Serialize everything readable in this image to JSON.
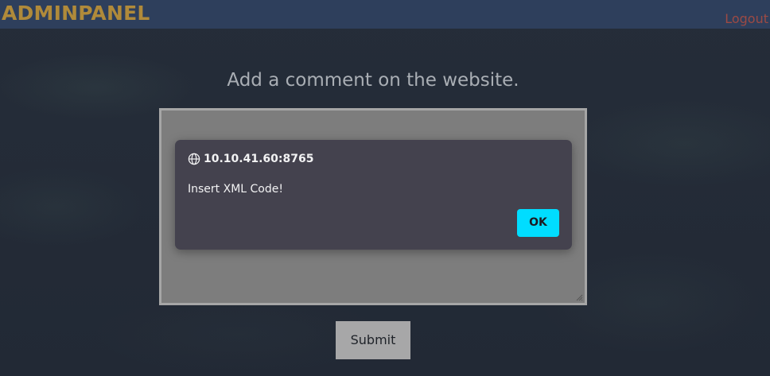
{
  "nav": {
    "brand": "ADMINPANEL",
    "logout_label": "Logout"
  },
  "main": {
    "heading": "Add a comment on the website.",
    "comment_value": "",
    "submit_label": "Submit"
  },
  "alert": {
    "origin": "10.10.41.60:8765",
    "origin_icon": "globe-icon",
    "message": "Insert XML Code!",
    "ok_label": "OK"
  },
  "colors": {
    "navbar": "#2e3f5c",
    "brand": "#b08a3a",
    "logout": "#9c4a44",
    "dialog_bg": "#44424e",
    "ok_button": "#00ddff"
  }
}
